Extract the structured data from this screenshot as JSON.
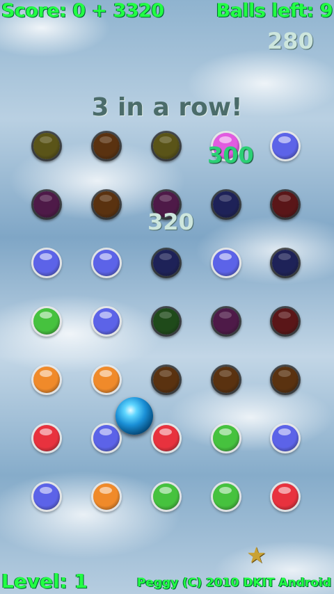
{
  "hud": {
    "score": "Score: 0 + 3320",
    "balls_left": "Balls left: 9",
    "level": "Level: 1",
    "credit": "Peggy (C) 2010 DKIT Android"
  },
  "popups": {
    "combo": "3 in a row!",
    "points_a": "280",
    "points_b": "300",
    "points_c": "320"
  },
  "colors": {
    "hud_text": "#22ff44",
    "player_ball": "#1a8fd6"
  },
  "icons": {
    "star": "star-icon"
  },
  "pegs": [
    {
      "row": 0,
      "col": 0,
      "color": "#5a5418",
      "state": "hit"
    },
    {
      "row": 0,
      "col": 1,
      "color": "#5a3210",
      "state": "hit"
    },
    {
      "row": 0,
      "col": 2,
      "color": "#5a5418",
      "state": "hit"
    },
    {
      "row": 0,
      "col": 3,
      "color": "#e25be0",
      "state": "lit"
    },
    {
      "row": 0,
      "col": 4,
      "color": "#5c63e8",
      "state": "lit"
    },
    {
      "row": 1,
      "col": 0,
      "color": "#4e1a48",
      "state": "hit"
    },
    {
      "row": 1,
      "col": 1,
      "color": "#5a3210",
      "state": "hit"
    },
    {
      "row": 1,
      "col": 2,
      "color": "#4e1a48",
      "state": "hit"
    },
    {
      "row": 1,
      "col": 3,
      "color": "#1e2258",
      "state": "hit"
    },
    {
      "row": 1,
      "col": 4,
      "color": "#5a1618",
      "state": "hit"
    },
    {
      "row": 2,
      "col": 0,
      "color": "#5c63e8",
      "state": "lit"
    },
    {
      "row": 2,
      "col": 1,
      "color": "#5c63e8",
      "state": "lit"
    },
    {
      "row": 2,
      "col": 2,
      "color": "#1e2258",
      "state": "hit"
    },
    {
      "row": 2,
      "col": 3,
      "color": "#5c63e8",
      "state": "lit"
    },
    {
      "row": 2,
      "col": 4,
      "color": "#1e2258",
      "state": "hit"
    },
    {
      "row": 3,
      "col": 0,
      "color": "#46c23e",
      "state": "lit"
    },
    {
      "row": 3,
      "col": 1,
      "color": "#5c63e8",
      "state": "lit"
    },
    {
      "row": 3,
      "col": 2,
      "color": "#1f4a1a",
      "state": "hit"
    },
    {
      "row": 3,
      "col": 3,
      "color": "#4e1a48",
      "state": "hit"
    },
    {
      "row": 3,
      "col": 4,
      "color": "#5a1618",
      "state": "hit"
    },
    {
      "row": 4,
      "col": 0,
      "color": "#f08a2a",
      "state": "lit"
    },
    {
      "row": 4,
      "col": 1,
      "color": "#f08a2a",
      "state": "lit"
    },
    {
      "row": 4,
      "col": 2,
      "color": "#5a3210",
      "state": "hit"
    },
    {
      "row": 4,
      "col": 3,
      "color": "#5a3210",
      "state": "hit"
    },
    {
      "row": 4,
      "col": 4,
      "color": "#5a3210",
      "state": "hit"
    },
    {
      "row": 5,
      "col": 0,
      "color": "#e8323e",
      "state": "lit"
    },
    {
      "row": 5,
      "col": 1,
      "color": "#5c63e8",
      "state": "lit"
    },
    {
      "row": 5,
      "col": 2,
      "color": "#e8323e",
      "state": "lit"
    },
    {
      "row": 5,
      "col": 3,
      "color": "#46c23e",
      "state": "lit"
    },
    {
      "row": 5,
      "col": 4,
      "color": "#5c63e8",
      "state": "lit"
    },
    {
      "row": 6,
      "col": 0,
      "color": "#5c63e8",
      "state": "lit"
    },
    {
      "row": 6,
      "col": 1,
      "color": "#f08a2a",
      "state": "lit"
    },
    {
      "row": 6,
      "col": 2,
      "color": "#46c23e",
      "state": "lit"
    },
    {
      "row": 6,
      "col": 3,
      "color": "#46c23e",
      "state": "lit"
    },
    {
      "row": 6,
      "col": 4,
      "color": "#e8323e",
      "state": "lit"
    }
  ]
}
